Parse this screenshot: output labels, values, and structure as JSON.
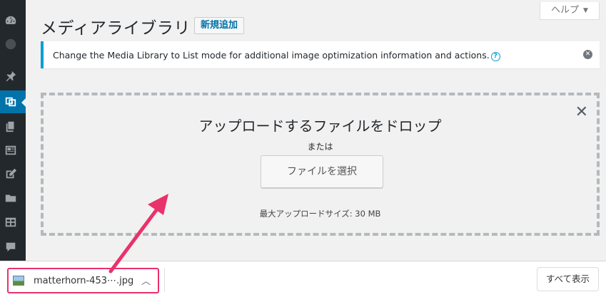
{
  "header": {
    "title": "メディアライブラリ",
    "add_new": "新規追加",
    "help": "ヘルプ"
  },
  "notice": {
    "text": "Change the Media Library to List mode for additional image optimization information and actions.",
    "help_glyph": "?",
    "dismiss_glyph": "✕"
  },
  "uploader": {
    "drop_text": "アップロードするファイルをドロップ",
    "or_text": "または",
    "select_button": "ファイルを選択",
    "max_size": "最大アップロードサイズ: 30 MB",
    "close_glyph": "✕"
  },
  "download_bar": {
    "file_name": "matterhorn-453⋯.jpg",
    "show_all": "すべて表示"
  },
  "sidebar": {
    "icons": [
      "dashboard-icon",
      "avatar-icon",
      "pin-icon",
      "media-icon",
      "pages-icon",
      "form-icon",
      "edit-icon",
      "folder-icon",
      "table-icon",
      "comment-icon"
    ]
  },
  "colors": {
    "sidebar_bg": "#23282d",
    "active_menu": "#0073aa",
    "notice_border": "#00a0d2",
    "annotation": "#e9326b"
  }
}
